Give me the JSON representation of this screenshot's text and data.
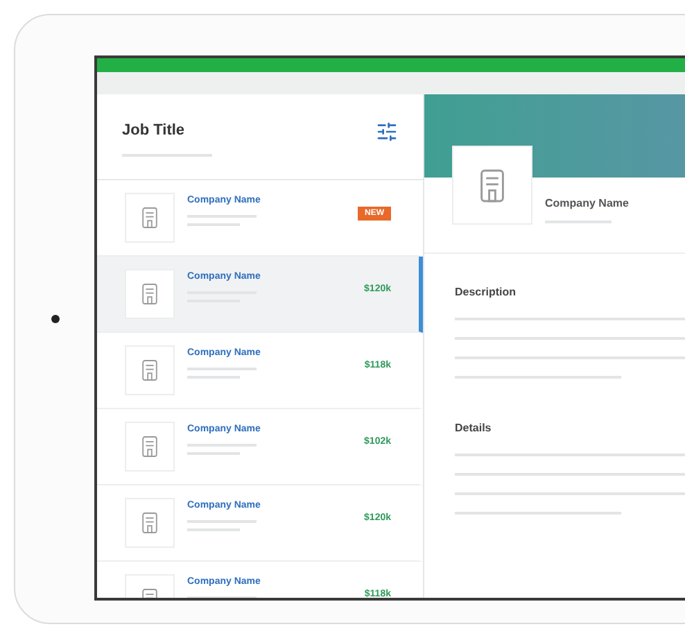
{
  "sidebar": {
    "title": "Job Title"
  },
  "jobs": [
    {
      "company": "Company Name",
      "kind": "badge",
      "tag": "NEW",
      "selected": false
    },
    {
      "company": "Company Name",
      "kind": "salary",
      "tag": "$120k",
      "selected": true
    },
    {
      "company": "Company Name",
      "kind": "salary",
      "tag": "$118k",
      "selected": false
    },
    {
      "company": "Company Name",
      "kind": "salary",
      "tag": "$102k",
      "selected": false
    },
    {
      "company": "Company Name",
      "kind": "salary",
      "tag": "$120k",
      "selected": false
    },
    {
      "company": "Company Name",
      "kind": "salary",
      "tag": "$118k",
      "selected": false
    }
  ],
  "detail": {
    "company": "Company Name",
    "sections": [
      "Description",
      "Details"
    ]
  }
}
